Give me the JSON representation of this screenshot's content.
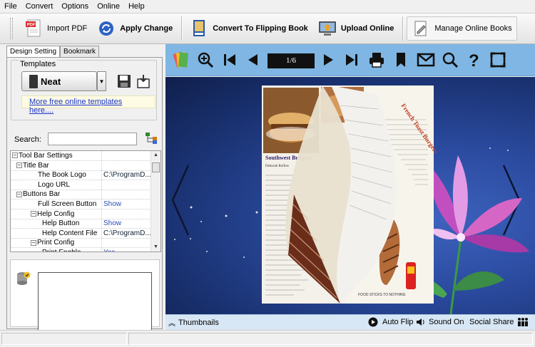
{
  "menu": [
    "File",
    "Convert",
    "Options",
    "Online",
    "Help"
  ],
  "toolbar": {
    "import_pdf": "Import PDF",
    "apply_change": "Apply Change",
    "convert": "Convert To Flipping Book",
    "upload": "Upload Online",
    "manage": "Manage Online Books"
  },
  "left": {
    "tabs": [
      "Design Setting",
      "Bookmark"
    ],
    "templates_label": "Templates",
    "template_name": "Neat",
    "more_templates": "More free online templates here....",
    "search_label": "Search:",
    "search_value": "",
    "tree": [
      {
        "key": "Tool Bar Settings",
        "value": "",
        "level": 0,
        "pm": "−"
      },
      {
        "key": "Title Bar",
        "value": "",
        "level": 1,
        "pm": "−"
      },
      {
        "key": "The Book Logo",
        "value": "C:\\ProgramD...",
        "level": 2,
        "pm": ""
      },
      {
        "key": "Logo URL",
        "value": "",
        "level": 2,
        "pm": ""
      },
      {
        "key": "Buttons Bar",
        "value": "",
        "level": 1,
        "pm": "−"
      },
      {
        "key": "Full Screen Button",
        "value": "Show",
        "level": 2,
        "pm": ""
      },
      {
        "key": "Help Config",
        "value": "",
        "level": 2,
        "pm": "−"
      },
      {
        "key": "Help Button",
        "value": "Show",
        "level": 3,
        "pm": ""
      },
      {
        "key": "Help Content File",
        "value": "C:\\ProgramD...",
        "level": 3,
        "pm": ""
      },
      {
        "key": "Print Config",
        "value": "",
        "level": 2,
        "pm": "−"
      },
      {
        "key": "Print Enable",
        "value": "Yes",
        "level": 3,
        "pm": ""
      }
    ]
  },
  "viewer": {
    "page_indicator": "1/6",
    "thumbnails": "Thumbnails",
    "auto_flip": "Auto Flip",
    "sound_on": "Sound On",
    "social_share": "Social Share",
    "book": {
      "left_heading": "Southwest Burgers",
      "left_byline": "Deborah Rollins",
      "left_caption": "FOOD STICKS TO NOTHING",
      "right_heading": "French Toast Burgers"
    }
  },
  "colors": {
    "viewer_toolbar": "#7fb6e3",
    "stage_bg": "#2b4ba0",
    "link": "#1a35c9"
  }
}
